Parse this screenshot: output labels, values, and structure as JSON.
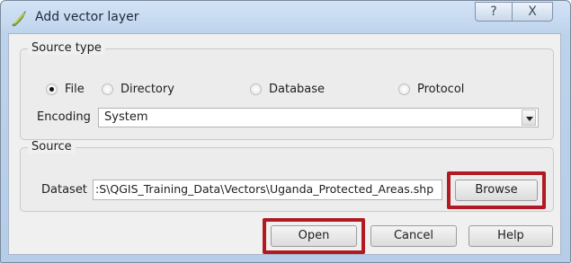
{
  "window": {
    "title": "Add vector layer",
    "help_button": "?",
    "close_button": "X"
  },
  "source_type": {
    "title": "Source type",
    "options": [
      {
        "label": "File",
        "checked": true
      },
      {
        "label": "Directory",
        "checked": false
      },
      {
        "label": "Database",
        "checked": false
      },
      {
        "label": "Protocol",
        "checked": false
      }
    ],
    "encoding_label": "Encoding",
    "encoding_value": "System"
  },
  "source": {
    "title": "Source",
    "dataset_label": "Dataset",
    "dataset_value": ":S\\QGIS_Training_Data\\Vectors\\Uganda_Protected_Areas.shp",
    "browse_label": "Browse"
  },
  "buttons": {
    "open": "Open",
    "cancel": "Cancel",
    "help": "Help"
  },
  "colors": {
    "highlight": "#b11a22",
    "qgis_green": "#7ab648"
  }
}
